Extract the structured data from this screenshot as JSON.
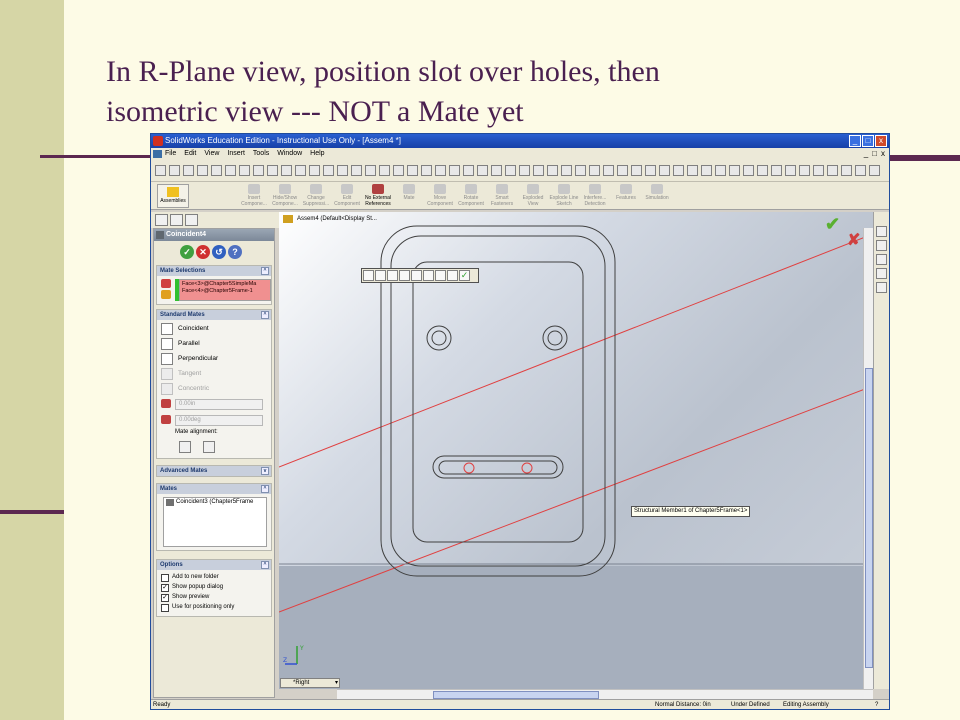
{
  "slide": {
    "title_line1": "In R-Plane view, position slot over holes, then",
    "title_line2": "isometric view --- NOT a Mate yet"
  },
  "window": {
    "title": "SolidWorks Education Edition - Instructional Use Only - [Assem4 *]",
    "controls": [
      "_",
      "□",
      "x"
    ],
    "mdi_controls": [
      "_",
      "□",
      "x"
    ]
  },
  "menu": [
    "File",
    "Edit",
    "View",
    "Insert",
    "Tools",
    "Window",
    "Help"
  ],
  "command_manager": {
    "tab": "Assemblies",
    "items": [
      {
        "label": "Insert Compone...",
        "enabled": false
      },
      {
        "label": "Hide/Show Compone...",
        "enabled": false
      },
      {
        "label": "Change Suppressi...",
        "enabled": false
      },
      {
        "label": "Edit Component",
        "enabled": false
      },
      {
        "label": "No External References",
        "enabled": true
      },
      {
        "label": "Mate",
        "enabled": false
      },
      {
        "label": "Move Component",
        "enabled": false
      },
      {
        "label": "Rotate Component",
        "enabled": false
      },
      {
        "label": "Smart Fasteners",
        "enabled": false
      },
      {
        "label": "Exploded View",
        "enabled": false
      },
      {
        "label": "Explode Line Sketch",
        "enabled": false
      },
      {
        "label": "Interfere... Detection",
        "enabled": false
      },
      {
        "label": "Features",
        "enabled": false
      },
      {
        "label": "Simulation",
        "enabled": false
      }
    ]
  },
  "property_manager": {
    "title": "Coincident4",
    "mate_selections": {
      "header": "Mate Selections",
      "items": [
        "Face<3>@Chapter5SimpleMa",
        "Face<4>@Chapter5Frame-1"
      ]
    },
    "standard_mates": {
      "header": "Standard Mates",
      "options": [
        {
          "label": "Coincident",
          "enabled": true,
          "icon": "coincident-icon"
        },
        {
          "label": "Parallel",
          "enabled": true,
          "icon": "parallel-icon"
        },
        {
          "label": "Perpendicular",
          "enabled": true,
          "icon": "perpendicular-icon"
        },
        {
          "label": "Tangent",
          "enabled": false,
          "icon": "tangent-icon"
        },
        {
          "label": "Concentric",
          "enabled": false,
          "icon": "concentric-icon"
        }
      ],
      "distance_value": "0.00in",
      "angle_value": "0.00deg",
      "mate_alignment_label": "Mate alignment:"
    },
    "advanced_mates": {
      "header": "Advanced Mates"
    },
    "mates": {
      "header": "Mates",
      "items": [
        "Coincident3 (Chapter5Frame"
      ]
    },
    "options": {
      "header": "Options",
      "checkboxes": [
        {
          "label": "Add to new folder",
          "checked": false
        },
        {
          "label": "Show popup dialog",
          "checked": true
        },
        {
          "label": "Show preview",
          "checked": true
        },
        {
          "label": "Use for positioning only",
          "checked": false
        }
      ]
    }
  },
  "viewport": {
    "tree_flyout": "Assem4  (Default<Display St...",
    "tooltip": "Structural Member1 of Chapter5Frame<1>",
    "view_orientation": "*Right",
    "triad_y": "Y",
    "triad_z": "Z"
  },
  "status_bar": {
    "left": "Ready",
    "normal_distance": "Normal Distance: 0in",
    "definition": "Under Defined",
    "mode": "Editing Assembly",
    "help": "?"
  },
  "colors": {
    "title_text": "#4a2050",
    "accent_rule": "#5c2850",
    "selection_highlight": "#f09090",
    "red_lines": "#e04040"
  }
}
